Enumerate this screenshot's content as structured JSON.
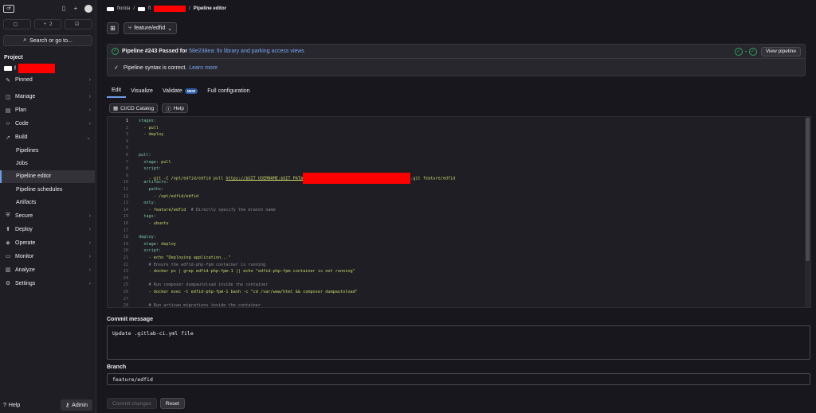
{
  "sidebar": {
    "logo": "ctf",
    "counters": [
      {
        "icon": "issues-icon",
        "count": ""
      },
      {
        "icon": "merge-request-icon",
        "count": "2"
      },
      {
        "icon": "todo-icon",
        "count": ""
      }
    ],
    "search_label": "Search or go to...",
    "section_title": "Project",
    "project_letter": "f",
    "items": [
      {
        "label": "Pinned",
        "icon": "pin-icon"
      },
      {
        "label": "Manage",
        "icon": "manage-icon"
      },
      {
        "label": "Plan",
        "icon": "plan-icon"
      },
      {
        "label": "Code",
        "icon": "code-icon"
      },
      {
        "label": "Build",
        "icon": "rocket-icon"
      }
    ],
    "build_sub": [
      "Pipelines",
      "Jobs",
      "Pipeline editor",
      "Pipeline schedules",
      "Artifacts"
    ],
    "items_after": [
      {
        "label": "Secure",
        "icon": "shield-icon"
      },
      {
        "label": "Deploy",
        "icon": "deploy-icon"
      },
      {
        "label": "Operate",
        "icon": "operate-icon"
      },
      {
        "label": "Monitor",
        "icon": "monitor-icon"
      },
      {
        "label": "Analyze",
        "icon": "chart-icon"
      },
      {
        "label": "Settings",
        "icon": "gear-icon"
      }
    ],
    "help_label": "Help",
    "admin_label": "Admin"
  },
  "breadcrumb": {
    "group": "florida",
    "project": "fl",
    "current": "Pipeline editor"
  },
  "toolbar": {
    "branch": "feature/edfid"
  },
  "pipeline": {
    "prefix": "Pipeline #243 Passed for",
    "commit": "58e238ea: fix library and parking access views",
    "view_button": "View pipeline",
    "syntax_msg": "Pipeline syntax is correct.",
    "learn_more": "Learn more"
  },
  "tabs": [
    {
      "label": "Edit"
    },
    {
      "label": "Visualize"
    },
    {
      "label": "Validate",
      "badge": "NEW"
    },
    {
      "label": "Full configuration"
    }
  ],
  "editor_tools": {
    "catalog": "CI/CD Catalog",
    "help": "Help"
  },
  "code_lines": [
    "stages:",
    "  - pull",
    "  - deploy",
    "",
    "",
    "pull:",
    "  stage: pull",
    "  script:",
    "    - git -C /opt/edfid/edfid pull https://$GIT_USERNAME:$GIT_PAT@",
    "  artifacts:",
    "    paths:",
    "      - /opt/edfid/edfid",
    "  only:",
    "    - feature/edfid  # Directly specify the branch name",
    "  tags:",
    "    - ubuntu",
    "",
    "deploy:",
    "  stage: deploy",
    "  script:",
    "    - echo \"Deploying application...\"",
    "    # Ensure the edfid-php-fpm container is running",
    "    - docker ps | grep edfid-php-fpm-1 || echo \"edfid-php-fpm container is not running\"",
    "",
    "    # Run composer dumpautoload inside the container",
    "    - docker exec -t edfid-php-fpm-1 bash -c \"cd /var/www/html && composer dumpautoload\"",
    "",
    "    # Run artisan migrations inside the container"
  ],
  "code_line9_tail": ".git feature/edfid",
  "commit_message": {
    "label": "Commit message",
    "value": "Update .gitlab-ci.yml file"
  },
  "branch_field": {
    "label": "Branch",
    "value": "feature/edfid"
  },
  "actions": {
    "commit": "Commit changes",
    "reset": "Reset"
  }
}
